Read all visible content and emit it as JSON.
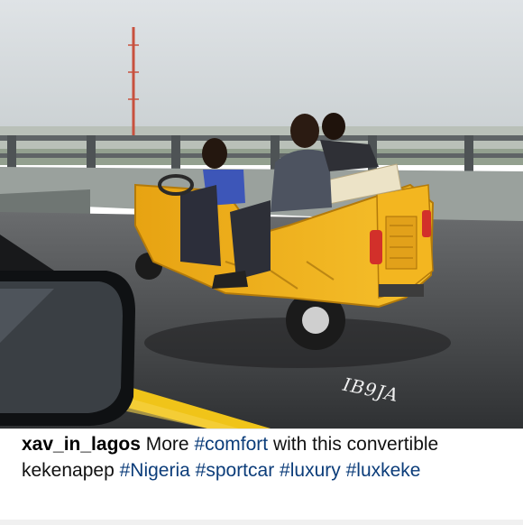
{
  "post": {
    "watermark": "IB9JA",
    "caption": {
      "username": "xav_in_lagos",
      "text1": "More ",
      "tag_comfort": "#comfort",
      "text2": " with this convertible kekenapep ",
      "tag_nigeria": "#Nigeria",
      "tag_sportcar": "#sportcar",
      "tag_luxury": "#luxury",
      "tag_luxkeke": "#luxkeke"
    }
  },
  "colors": {
    "tag": "#0c3d7a",
    "keke_body": "#f2b21b",
    "road": "#3b3d40",
    "lane_line": "#f0c419"
  }
}
